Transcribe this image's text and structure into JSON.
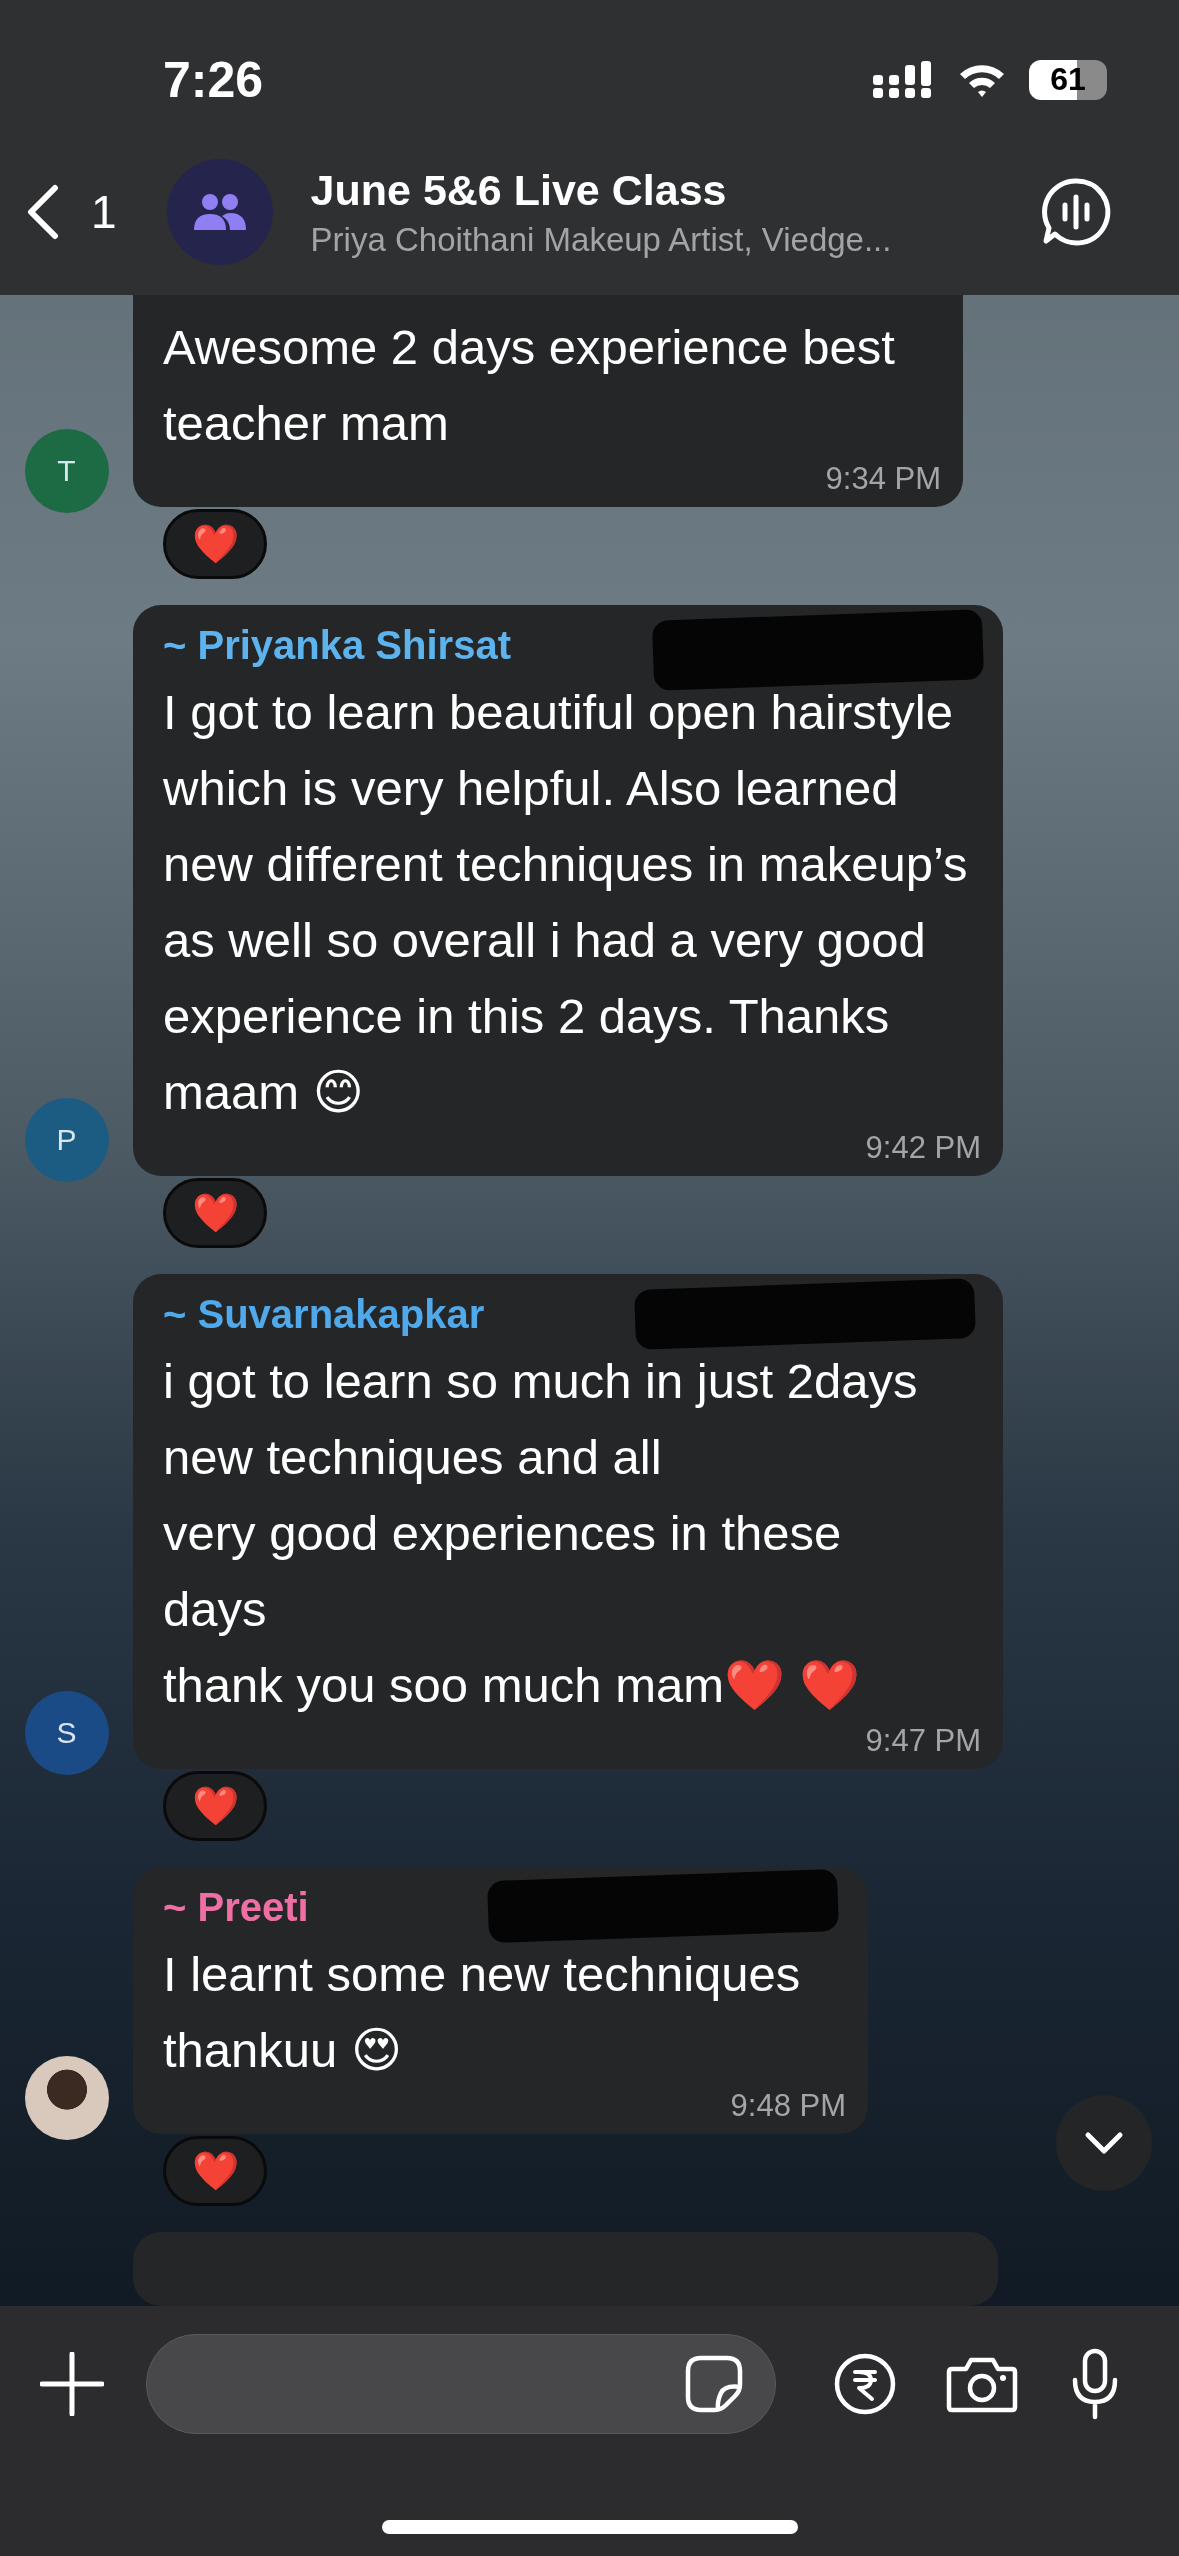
{
  "status_bar": {
    "time": "7:26",
    "battery": "61"
  },
  "header": {
    "back_count": "1",
    "title": "June 5&6 Live Class",
    "subtitle": "Priya Choithani Makeup Artist, Viedge..."
  },
  "messages": [
    {
      "kind": "cut",
      "avatar": {
        "kind": "letter",
        "letter": "T",
        "color": "#1d6b45"
      },
      "text": "Awesome 2 days experience best teacher mam",
      "time": "9:34 PM",
      "reaction": "❤️"
    },
    {
      "kind": "full",
      "avatar": {
        "kind": "letter",
        "letter": "P",
        "color": "#1c5b82"
      },
      "sender": {
        "name": "~ Priyanka Shirsat",
        "color": "#5db3ee"
      },
      "text": "I got to learn beautiful open hairstyle which is very helpful. Also learned new different techniques in makeup’s as well so overall i had a very good experience in this 2 days. Thanks maam 😊",
      "time": "9:42 PM",
      "reaction": "❤️"
    },
    {
      "kind": "full",
      "avatar": {
        "kind": "letter",
        "letter": "S",
        "color": "#1b4b87"
      },
      "sender": {
        "name": "~ Suvarnakapkar",
        "color": "#4fa9ea"
      },
      "text": "i got to learn so much in just 2days\nnew techniques and all\nvery good experiences in these\ndays\nthank you soo much mam❤️ ❤️",
      "time": "9:47 PM",
      "reaction": "❤️"
    },
    {
      "kind": "full",
      "avatar": {
        "kind": "photo"
      },
      "sender": {
        "name": "~ Preeti",
        "color": "#ee6fa6"
      },
      "text": "I learnt some new techniques thankuu 😍",
      "time": "9:48 PM",
      "reaction": "❤️"
    }
  ]
}
